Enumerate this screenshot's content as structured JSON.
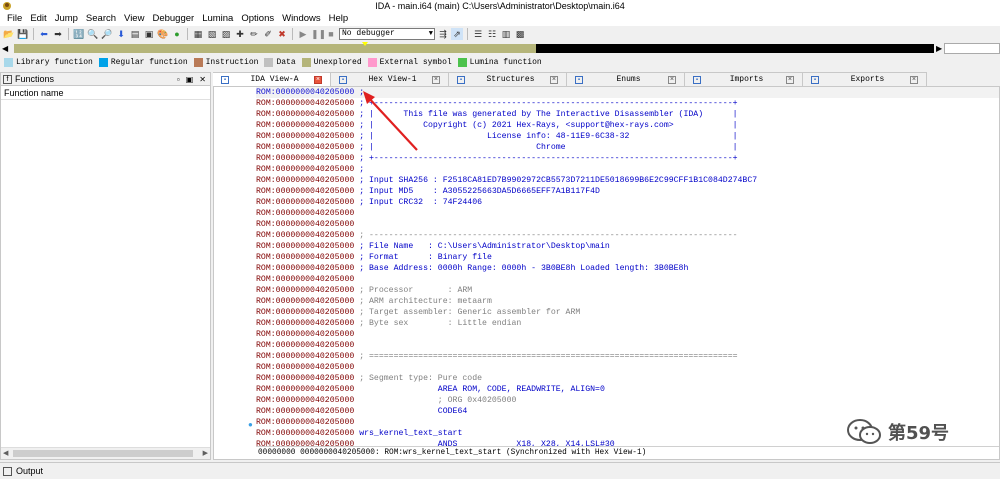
{
  "window": {
    "title": "IDA - main.i64 (main) C:\\Users\\Administrator\\Desktop\\main.i64"
  },
  "menu": [
    "File",
    "Edit",
    "Jump",
    "Search",
    "View",
    "Debugger",
    "Lumina",
    "Options",
    "Windows",
    "Help"
  ],
  "toolbar": {
    "debugger_select": "No debugger"
  },
  "legend": [
    {
      "label": "Library function",
      "color": "#a8d8ea"
    },
    {
      "label": "Regular function",
      "color": "#00a2e8"
    },
    {
      "label": "Instruction",
      "color": "#b97a57"
    },
    {
      "label": "Data",
      "color": "#c0c0c0"
    },
    {
      "label": "Unexplored",
      "color": "#b5b57a"
    },
    {
      "label": "External symbol",
      "color": "#ff99cc"
    },
    {
      "label": "Lumina function",
      "color": "#4cc24c"
    }
  ],
  "functions_panel": {
    "title": "Functions",
    "column": "Function name"
  },
  "tabs": [
    {
      "label": "IDA View-A",
      "active": true,
      "icon": "listing-icon"
    },
    {
      "label": "Hex View-1",
      "active": false,
      "icon": "hex-icon"
    },
    {
      "label": "Structures",
      "active": false,
      "icon": "struct-icon"
    },
    {
      "label": "Enums",
      "active": false,
      "icon": "enum-icon"
    },
    {
      "label": "Imports",
      "active": false,
      "icon": "import-icon"
    },
    {
      "label": "Exports",
      "active": false,
      "icon": "export-icon"
    }
  ],
  "listing": {
    "addr": "ROM:0000000040205000",
    "lines": [
      {
        "t": " ;",
        "c": "cm"
      },
      {
        "t": " ; +-------------------------------------------------------------------------+",
        "c": "cm"
      },
      {
        "t": " ; |      This file was generated by The Interactive Disassembler (IDA)      |",
        "c": "cm"
      },
      {
        "t": " ; |          Copyright (c) 2021 Hex-Rays, <support@hex-rays.com>            |",
        "c": "cm"
      },
      {
        "t": " ; |                       License info: 48-11E9-6C38-32                     |",
        "c": "cm"
      },
      {
        "t": " ; |                                 Chrome                                  |",
        "c": "cm"
      },
      {
        "t": " ; +-------------------------------------------------------------------------+",
        "c": "cm"
      },
      {
        "t": " ;",
        "c": "cm"
      },
      {
        "t": " ; Input SHA256 : F2518CA81ED7B9902972CB5573D7211DE5018699B6E2C99CFF1B1C084D274BC7",
        "c": "cm"
      },
      {
        "t": " ; Input MD5    : A3055225663DA5D6665EFF7A1B117F4D",
        "c": "cm"
      },
      {
        "t": " ; Input CRC32  : 74F24406",
        "c": "cm"
      },
      {
        "t": "",
        "c": "cm"
      },
      {
        "t": "",
        "c": "cm"
      },
      {
        "t": " ; ---------------------------------------------------------------------------",
        "c": "gr"
      },
      {
        "t": " ; File Name   : C:\\Users\\Administrator\\Desktop\\main",
        "c": "cm"
      },
      {
        "t": " ; Format      : Binary file",
        "c": "cm"
      },
      {
        "t": " ; Base Address: 0000h Range: 0000h - 3B0BE8h Loaded length: 3B0BE8h",
        "c": "cm"
      },
      {
        "t": "",
        "c": "cm"
      },
      {
        "t": " ; Processor       : ARM",
        "c": "gr"
      },
      {
        "t": " ; ARM architecture: metaarm",
        "c": "gr"
      },
      {
        "t": " ; Target assembler: Generic assembler for ARM",
        "c": "gr"
      },
      {
        "t": " ; Byte sex        : Little endian",
        "c": "gr"
      },
      {
        "t": "",
        "c": "cm"
      },
      {
        "t": "",
        "c": "cm"
      },
      {
        "t": " ; ===========================================================================",
        "c": "gr"
      },
      {
        "t": "",
        "c": "cm"
      },
      {
        "t": " ; Segment type: Pure code",
        "c": "gr"
      },
      {
        "t": "                 AREA ROM, CODE, READWRITE, ALIGN=0",
        "c": "ins"
      },
      {
        "t": "                 ; ORG 0x40205000",
        "c": "gr"
      },
      {
        "t": "                 CODE64",
        "c": "ins"
      },
      {
        "t": "",
        "c": "cm"
      },
      {
        "t": " wrs_kernel_text_start",
        "c": "lbl"
      },
      {
        "t": "                 ANDS            X18, X28, X14,LSL#30",
        "c": "ins"
      },
      {
        "t": " ; ---------------------------------------------------------------------------",
        "c": "gr"
      }
    ]
  },
  "status_line": "00000000 0000000040205000: ROM:wrs_kernel_text_start (Synchronized with Hex View-1)",
  "output_panel": {
    "title": "Output"
  },
  "watermark": {
    "text": "第59号"
  }
}
